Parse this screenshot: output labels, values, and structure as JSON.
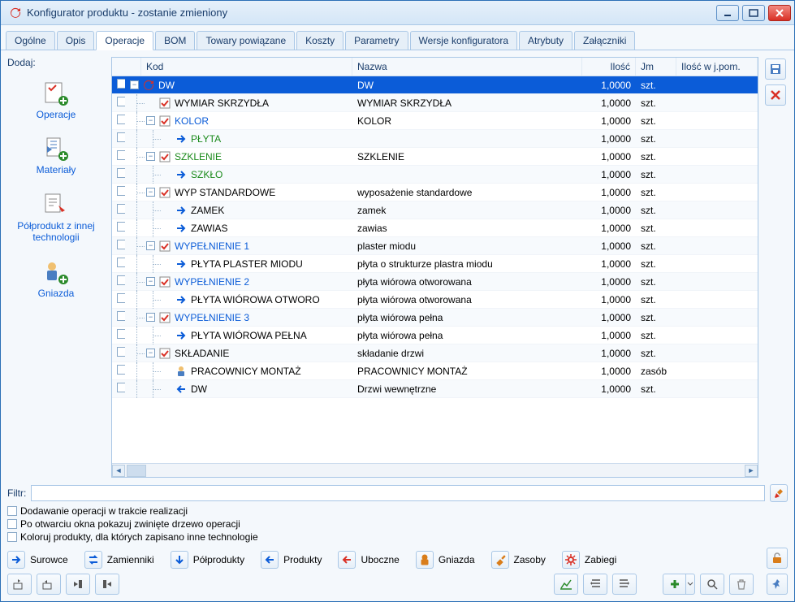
{
  "window": {
    "title": "Konfigurator produktu - zostanie zmieniony"
  },
  "tabs": [
    {
      "label": "Ogólne"
    },
    {
      "label": "Opis"
    },
    {
      "label": "Operacje",
      "active": true
    },
    {
      "label": "BOM"
    },
    {
      "label": "Towary powiązane"
    },
    {
      "label": "Koszty"
    },
    {
      "label": "Parametry"
    },
    {
      "label": "Wersje konfiguratora"
    },
    {
      "label": "Atrybuty"
    },
    {
      "label": "Załączniki"
    }
  ],
  "sidebar": {
    "title": "Dodaj:",
    "items": [
      {
        "label": "Operacje",
        "icon": "operations"
      },
      {
        "label": "Materiały",
        "icon": "materials"
      },
      {
        "label": "Półprodukt z innej technologii",
        "icon": "halfproduct"
      },
      {
        "label": "Gniazda",
        "icon": "nests"
      }
    ]
  },
  "grid": {
    "headers": {
      "kod": "Kod",
      "nazwa": "Nazwa",
      "ilosc": "Ilość",
      "jm": "Jm",
      "jpom": "Ilość w j.pom."
    },
    "rows": [
      {
        "level": 0,
        "exp": "-",
        "icon": "refresh",
        "kod": "DW",
        "kodColor": "white",
        "nazwa": "DW",
        "ilosc": "1,0000",
        "jm": "szt.",
        "selected": true
      },
      {
        "level": 1,
        "exp": "",
        "icon": "check",
        "kod": "WYMIAR SKRZYDŁA",
        "kodColor": "black",
        "nazwa": "WYMIAR SKRZYDŁA",
        "ilosc": "1,0000",
        "jm": "szt."
      },
      {
        "level": 1,
        "exp": "-",
        "icon": "check",
        "kod": "KOLOR",
        "kodColor": "blue",
        "nazwa": "KOLOR",
        "ilosc": "1,0000",
        "jm": "szt."
      },
      {
        "level": 2,
        "exp": "",
        "icon": "arrow-right",
        "kod": "PŁYTA",
        "kodColor": "green",
        "nazwa": "",
        "ilosc": "1,0000",
        "jm": "szt."
      },
      {
        "level": 1,
        "exp": "-",
        "icon": "check",
        "kod": "SZKLENIE",
        "kodColor": "green",
        "nazwa": "SZKLENIE",
        "ilosc": "1,0000",
        "jm": "szt."
      },
      {
        "level": 2,
        "exp": "",
        "icon": "arrow-right",
        "kod": "SZKŁO",
        "kodColor": "green",
        "nazwa": "",
        "ilosc": "1,0000",
        "jm": "szt."
      },
      {
        "level": 1,
        "exp": "-",
        "icon": "check",
        "kod": "WYP STANDARDOWE",
        "kodColor": "black",
        "nazwa": "wyposażenie standardowe",
        "ilosc": "1,0000",
        "jm": "szt."
      },
      {
        "level": 2,
        "exp": "",
        "icon": "arrow-right",
        "kod": "ZAMEK",
        "kodColor": "black",
        "nazwa": "zamek",
        "ilosc": "1,0000",
        "jm": "szt."
      },
      {
        "level": 2,
        "exp": "",
        "icon": "arrow-right",
        "kod": "ZAWIAS",
        "kodColor": "black",
        "nazwa": "zawias",
        "ilosc": "1,0000",
        "jm": "szt."
      },
      {
        "level": 1,
        "exp": "-",
        "icon": "check",
        "kod": "WYPEŁNIENIE 1",
        "kodColor": "blue",
        "nazwa": "plaster miodu",
        "ilosc": "1,0000",
        "jm": "szt."
      },
      {
        "level": 2,
        "exp": "",
        "icon": "arrow-right",
        "kod": "PŁYTA PLASTER MIODU",
        "kodColor": "black",
        "nazwa": "płyta o strukturze plastra miodu",
        "ilosc": "1,0000",
        "jm": "szt."
      },
      {
        "level": 1,
        "exp": "-",
        "icon": "check",
        "kod": "WYPEŁNIENIE 2",
        "kodColor": "blue",
        "nazwa": "płyta wiórowa otworowana",
        "ilosc": "1,0000",
        "jm": "szt."
      },
      {
        "level": 2,
        "exp": "",
        "icon": "arrow-right",
        "kod": "PŁYTA WIÓROWA OTWORO",
        "kodColor": "black",
        "nazwa": "płyta wiórowa otworowana",
        "ilosc": "1,0000",
        "jm": "szt."
      },
      {
        "level": 1,
        "exp": "-",
        "icon": "check",
        "kod": "WYPEŁNIENIE 3",
        "kodColor": "blue",
        "nazwa": "płyta wiórowa pełna",
        "ilosc": "1,0000",
        "jm": "szt."
      },
      {
        "level": 2,
        "exp": "",
        "icon": "arrow-right",
        "kod": "PŁYTA WIÓROWA PEŁNA",
        "kodColor": "black",
        "nazwa": "płyta wiórowa pełna",
        "ilosc": "1,0000",
        "jm": "szt."
      },
      {
        "level": 1,
        "exp": "-",
        "icon": "check",
        "kod": "SKŁADANIE",
        "kodColor": "black",
        "nazwa": "składanie drzwi",
        "ilosc": "1,0000",
        "jm": "szt."
      },
      {
        "level": 2,
        "exp": "",
        "icon": "person",
        "kod": "PRACOWNICY MONTAŻ",
        "kodColor": "black",
        "nazwa": "PRACOWNICY MONTAŻ",
        "ilosc": "1,0000",
        "jm": "zasób"
      },
      {
        "level": 2,
        "exp": "",
        "icon": "arrow-left",
        "kod": "DW",
        "kodColor": "black",
        "nazwa": "Drzwi wewnętrzne",
        "ilosc": "1,0000",
        "jm": "szt."
      }
    ]
  },
  "filter": {
    "label": "Filtr:",
    "value": ""
  },
  "checks": [
    {
      "label": "Dodawanie operacji w trakcie realizacji"
    },
    {
      "label": "Po otwarciu okna pokazuj zwinięte drzewo operacji"
    },
    {
      "label": "Koloruj produkty, dla których zapisano inne technologie"
    }
  ],
  "legend": [
    {
      "label": "Surowce",
      "icon": "arrow-right",
      "color": "#0b5cd8"
    },
    {
      "label": "Zamienniki",
      "icon": "arrow-swap",
      "color": "#0b5cd8"
    },
    {
      "label": "Półprodukty",
      "icon": "arrow-down",
      "color": "#0b5cd8"
    },
    {
      "label": "Produkty",
      "icon": "arrow-left",
      "color": "#0b5cd8"
    },
    {
      "label": "Uboczne",
      "icon": "arrow-left",
      "color": "#d93025"
    },
    {
      "label": "Gniazda",
      "icon": "person",
      "color": "#d97d1a"
    },
    {
      "label": "Zasoby",
      "icon": "tool",
      "color": "#d97d1a"
    },
    {
      "label": "Zabiegi",
      "icon": "gear",
      "color": "#d93025"
    }
  ]
}
